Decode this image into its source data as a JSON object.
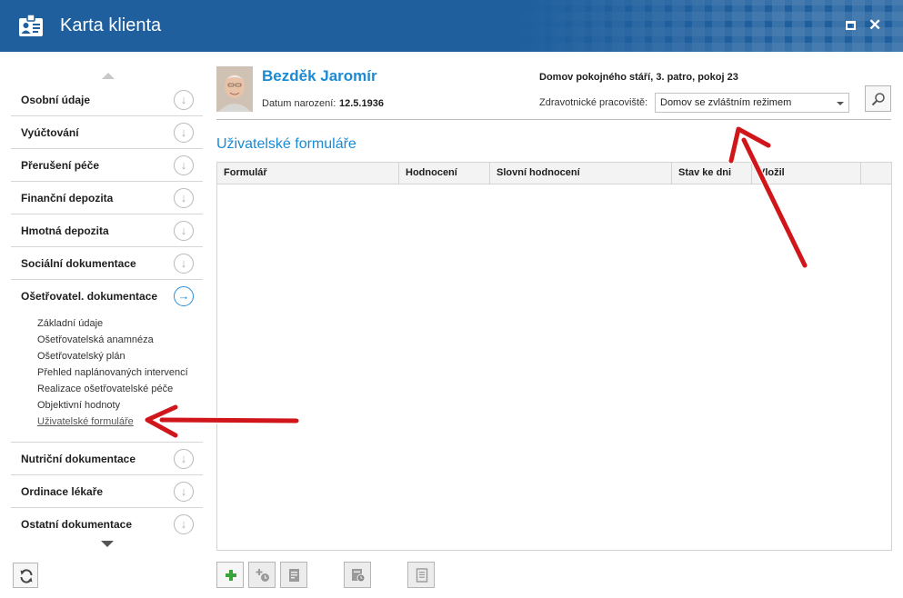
{
  "window": {
    "title": "Karta klienta",
    "icons": {
      "app": "id-card-icon",
      "maximize": "maximize-icon",
      "close": "close-icon"
    },
    "close_glyph": "✕"
  },
  "colors": {
    "titlebar": "#1f5f9e",
    "accent": "#1a8ad4",
    "annotation_arrow": "#d0161b"
  },
  "sidebar": {
    "items": [
      {
        "label": "Osobní údaje",
        "icon": "arrow-down-circle-icon"
      },
      {
        "label": "Vyúčtování",
        "icon": "arrow-down-circle-icon"
      },
      {
        "label": "Přerušení péče",
        "icon": "arrow-down-circle-icon"
      },
      {
        "label": "Finanční depozita",
        "icon": "arrow-down-circle-icon"
      },
      {
        "label": "Hmotná depozita",
        "icon": "arrow-down-circle-icon"
      },
      {
        "label": "Sociální dokumentace",
        "icon": "arrow-down-circle-icon"
      },
      {
        "label": "Ošetřovatel. dokumentace",
        "icon": "arrow-right-circle-icon",
        "active": true
      },
      {
        "label": "Nutriční dokumentace",
        "icon": "arrow-down-circle-icon"
      },
      {
        "label": "Ordinace lékaře",
        "icon": "arrow-down-circle-icon"
      },
      {
        "label": "Ostatní dokumentace",
        "icon": "arrow-down-circle-icon"
      }
    ],
    "subitems": [
      "Základní údaje",
      "Ošetřovatelská anamnéza",
      "Ošetřovatelský plán",
      "Přehled naplánovaných intervencí",
      "Realizace ošetřovatelské péče",
      "Objektivní hodnoty",
      "Uživatelské formuláře"
    ],
    "current_subitem": "Uživatelské formuláře",
    "refresh_icon": "refresh-icon"
  },
  "client": {
    "name": "Bezděk Jaromír",
    "dob_label": "Datum narození:",
    "dob": "12.5.1936",
    "facility": "Domov pokojného stáří, 3. patro, pokoj 23",
    "ward_label": "Zdravotnické pracoviště:",
    "ward_value": "Domov se zvláštním režimem"
  },
  "section": {
    "title": "Uživatelské formuláře"
  },
  "table": {
    "columns": [
      "Formulář",
      "Hodnocení",
      "Slovní hodnocení",
      "Stav ke dni",
      "Vložil"
    ],
    "rows": []
  },
  "toolbar": {
    "buttons": [
      {
        "icon": "add-icon",
        "enabled": true
      },
      {
        "icon": "add-scheduled-icon",
        "enabled": false
      },
      {
        "icon": "edit-document-icon",
        "enabled": false
      },
      {
        "icon": "document-history-icon",
        "enabled": false
      },
      {
        "icon": "document-icon",
        "enabled": false
      }
    ]
  }
}
